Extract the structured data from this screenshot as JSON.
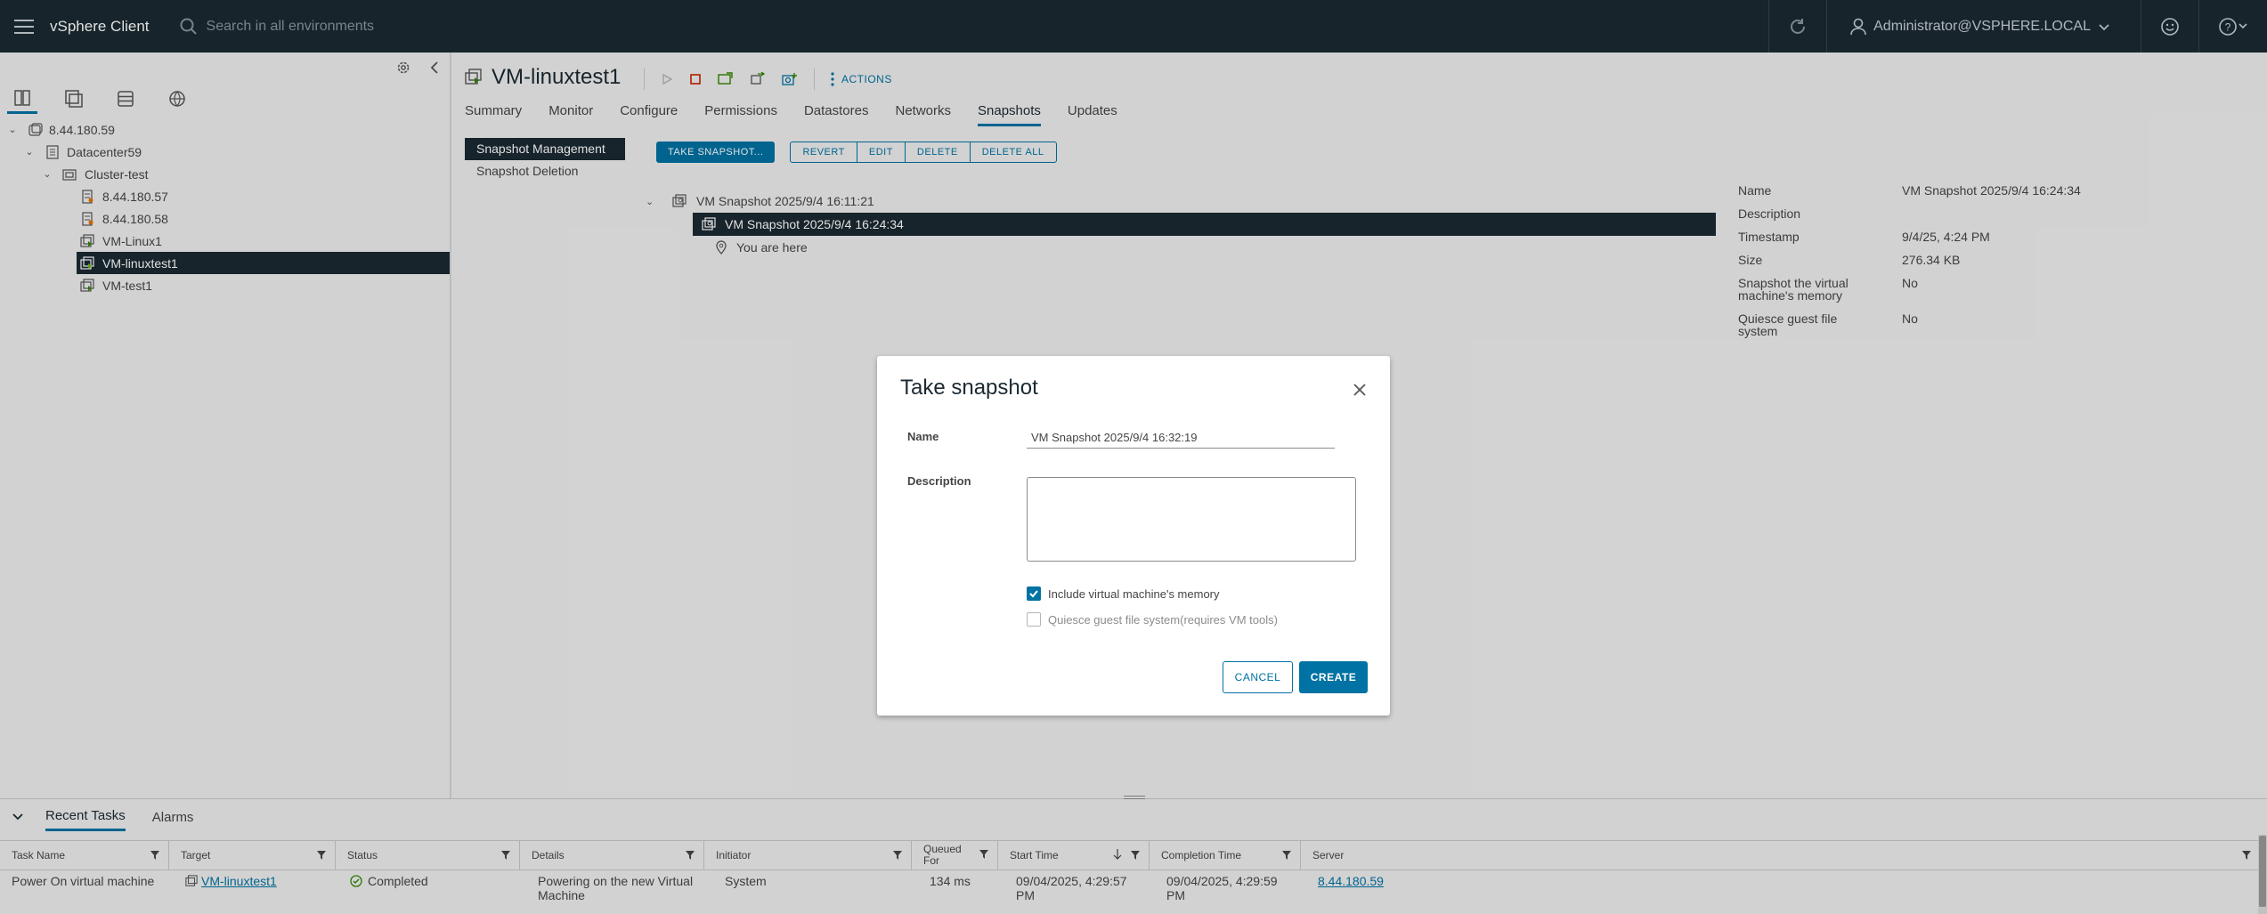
{
  "topbar": {
    "app_title": "vSphere Client",
    "search_placeholder": "Search in all environments",
    "user": "Administrator@VSPHERE.LOCAL"
  },
  "tree": {
    "items": [
      {
        "label": "8.44.180.59",
        "type": "vcenter"
      },
      {
        "label": "Datacenter59",
        "type": "datacenter"
      },
      {
        "label": "Cluster-test",
        "type": "cluster"
      },
      {
        "label": "8.44.180.57",
        "type": "host"
      },
      {
        "label": "8.44.180.58",
        "type": "host"
      },
      {
        "label": "VM-Linux1",
        "type": "vm"
      },
      {
        "label": "VM-linuxtest1",
        "type": "vm",
        "selected": true
      },
      {
        "label": "VM-test1",
        "type": "vm"
      }
    ]
  },
  "vm": {
    "title": "VM-linuxtest1",
    "actions_label": "ACTIONS"
  },
  "tabs": [
    "Summary",
    "Monitor",
    "Configure",
    "Permissions",
    "Datastores",
    "Networks",
    "Snapshots",
    "Updates"
  ],
  "active_tab": "Snapshots",
  "snapshot_menu": [
    "Snapshot Management",
    "Snapshot Deletion"
  ],
  "buttons": {
    "take_snapshot": "TAKE SNAPSHOT...",
    "revert": "REVERT",
    "edit": "EDIT",
    "delete": "DELETE",
    "delete_all": "DELETE ALL"
  },
  "snapshots": {
    "root": "VM Snapshot 2025/9/4 16:11:21",
    "child": "VM Snapshot 2025/9/4 16:24:34",
    "you_are_here": "You are here"
  },
  "details": {
    "rows": [
      {
        "key": "Name",
        "value": "VM Snapshot 2025/9/4 16:24:34"
      },
      {
        "key": "Description",
        "value": ""
      },
      {
        "key": "Timestamp",
        "value": "9/4/25, 4:24 PM"
      },
      {
        "key": "Size",
        "value": "276.34 KB"
      },
      {
        "key": "Snapshot the virtual machine's memory",
        "value": "No"
      },
      {
        "key": "Quiesce guest file system",
        "value": "No"
      }
    ]
  },
  "modal": {
    "title": "Take snapshot",
    "name_label": "Name",
    "name_value": "VM Snapshot 2025/9/4 16:32:19",
    "description_label": "Description",
    "include_memory_label": "Include virtual machine's memory",
    "include_memory_checked": true,
    "quiesce_label": "Quiesce guest file system(requires VM tools)",
    "quiesce_checked": false,
    "cancel": "CANCEL",
    "create": "CREATE"
  },
  "bottom": {
    "tabs": [
      "Recent Tasks",
      "Alarms"
    ],
    "columns": [
      "Task Name",
      "Target",
      "Status",
      "Details",
      "Initiator",
      "Queued For",
      "Start Time",
      "Completion Time",
      "Server"
    ],
    "rows": [
      {
        "task_name": "Power On virtual machine",
        "target": "VM-linuxtest1",
        "status": "Completed",
        "details": "Powering on the new Virtual Machine",
        "initiator": "System",
        "queued_for": "134 ms",
        "start_time": "09/04/2025, 4:29:57 PM",
        "completion_time": "09/04/2025, 4:29:59 PM",
        "server": "8.44.180.59"
      }
    ]
  },
  "colors": {
    "accent": "#0072a3",
    "header": "#1b2a32",
    "completed": "#2f8400"
  }
}
